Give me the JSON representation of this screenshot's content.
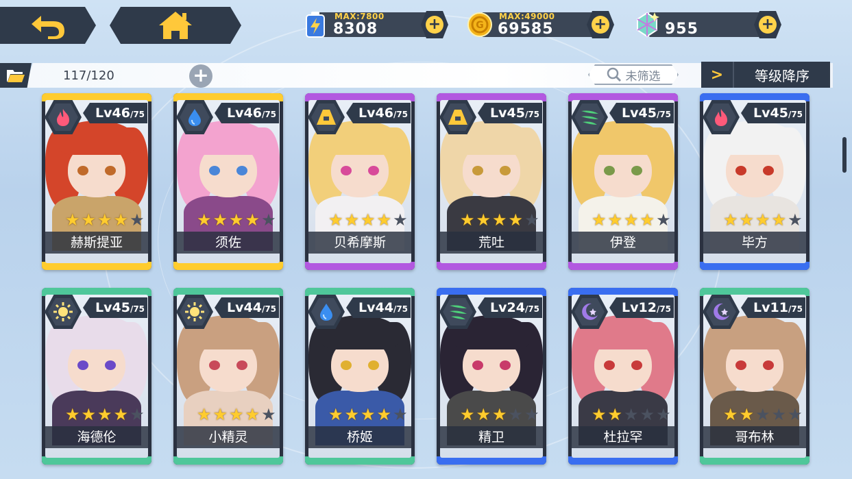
{
  "topbar": {
    "resources": [
      {
        "max_label": "MAX:7800",
        "value": "8308",
        "icon": "energy-battery-icon"
      },
      {
        "max_label": "MAX:49000",
        "value": "69585",
        "icon": "gold-coin-icon"
      },
      {
        "max_label": "",
        "value": "955",
        "icon": "crystal-gem-icon"
      }
    ]
  },
  "toolbar": {
    "count": "117/120",
    "filter_label": "未筛选",
    "sort_label": "等级降序"
  },
  "colors": {
    "gold": "#ffcc2e",
    "purple": "#b258e0",
    "blue": "#3a6ef0",
    "green": "#4fc79a",
    "dark": "#2f3a4a"
  },
  "cards": [
    {
      "level": "Lv46",
      "max": "/75",
      "name": "赫斯提亚",
      "stars": 4,
      "element": "fire",
      "rarity": "gold",
      "hair": "#d4452a",
      "eye": "#c06a2a",
      "outfit": "#c9a46a"
    },
    {
      "level": "Lv46",
      "max": "/75",
      "name": "须佐",
      "stars": 4,
      "element": "water",
      "rarity": "gold",
      "hair": "#f3a3cf",
      "eye": "#4a86d8",
      "outfit": "#8a4a8a"
    },
    {
      "level": "Lv46",
      "max": "/75",
      "name": "贝希摩斯",
      "stars": 4,
      "element": "earth",
      "rarity": "purple",
      "hair": "#f2cf7a",
      "eye": "#d84a9a",
      "outfit": "#f2f0f2"
    },
    {
      "level": "Lv45",
      "max": "/75",
      "name": "荒吐",
      "stars": 4,
      "element": "earth",
      "rarity": "purple",
      "hair": "#efd6a8",
      "eye": "#c89a3a",
      "outfit": "#3a3a42"
    },
    {
      "level": "Lv45",
      "max": "/75",
      "name": "伊登",
      "stars": 4,
      "element": "wind",
      "rarity": "purple",
      "hair": "#f0c76a",
      "eye": "#7a9a4a",
      "outfit": "#f4f2ea"
    },
    {
      "level": "Lv45",
      "max": "/75",
      "name": "毕方",
      "stars": 4,
      "element": "fire",
      "rarity": "blue",
      "hair": "#f2f2f2",
      "eye": "#c83a2a",
      "outfit": "#e8e4e0"
    },
    {
      "level": "Lv45",
      "max": "/75",
      "name": "海德伦",
      "stars": 4,
      "element": "light",
      "rarity": "green",
      "hair": "#e8dcea",
      "eye": "#6a4ac8",
      "outfit": "#4a3a5a"
    },
    {
      "level": "Lv44",
      "max": "/75",
      "name": "小精灵",
      "stars": 4,
      "element": "light",
      "rarity": "green",
      "hair": "#c9a080",
      "eye": "#c84a5a",
      "outfit": "#e8d0c0"
    },
    {
      "level": "Lv44",
      "max": "/75",
      "name": "桥姬",
      "stars": 4,
      "element": "water",
      "rarity": "green",
      "hair": "#2a2a34",
      "eye": "#e0b030",
      "outfit": "#3a5aa8"
    },
    {
      "level": "Lv24",
      "max": "/75",
      "name": "精卫",
      "stars": 3,
      "element": "wind",
      "rarity": "blue",
      "hair": "#2a2434",
      "eye": "#c83a6a",
      "outfit": "#4a4a4a"
    },
    {
      "level": "Lv12",
      "max": "/75",
      "name": "杜拉罕",
      "stars": 2,
      "element": "dark",
      "rarity": "blue",
      "hair": "#e07a8a",
      "eye": "#c83a3a",
      "outfit": "#3a3a46"
    },
    {
      "level": "Lv11",
      "max": "/75",
      "name": "哥布林",
      "stars": 2,
      "element": "dark",
      "rarity": "green",
      "hair": "#c8a080",
      "eye": "#c83a3a",
      "outfit": "#6a5a4a"
    }
  ]
}
